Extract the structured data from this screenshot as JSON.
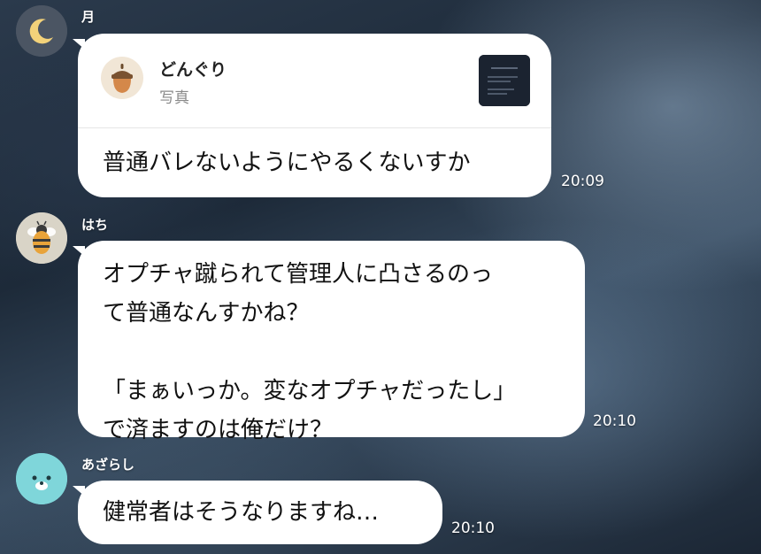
{
  "messages": [
    {
      "sender": "月",
      "avatar_icon": "moon-icon",
      "reply": {
        "name": "どんぐり",
        "type": "写真",
        "icon": "acorn-icon"
      },
      "text": "普通バレないようにやるくないすか",
      "time": "20:09"
    },
    {
      "sender": "はち",
      "avatar_icon": "bee-icon",
      "text": "オプチャ蹴られて管理人に凸さるのっ\nて普通なんすかね？\n\n「まぁいっか。変なオプチャだったし」\nで済ますのは俺だけ？",
      "time": "20:10"
    },
    {
      "sender": "あざらし",
      "avatar_icon": "seal-icon",
      "text": "健常者はそうなりますね…",
      "time": "20:10"
    }
  ],
  "colors": {
    "bubble": "#ffffff",
    "moon_avatar_bg": "#4b5563",
    "moon": "#f3d27a",
    "bee_avatar_bg": "#d9d4c7",
    "seal_avatar_bg": "#7fd6da"
  }
}
